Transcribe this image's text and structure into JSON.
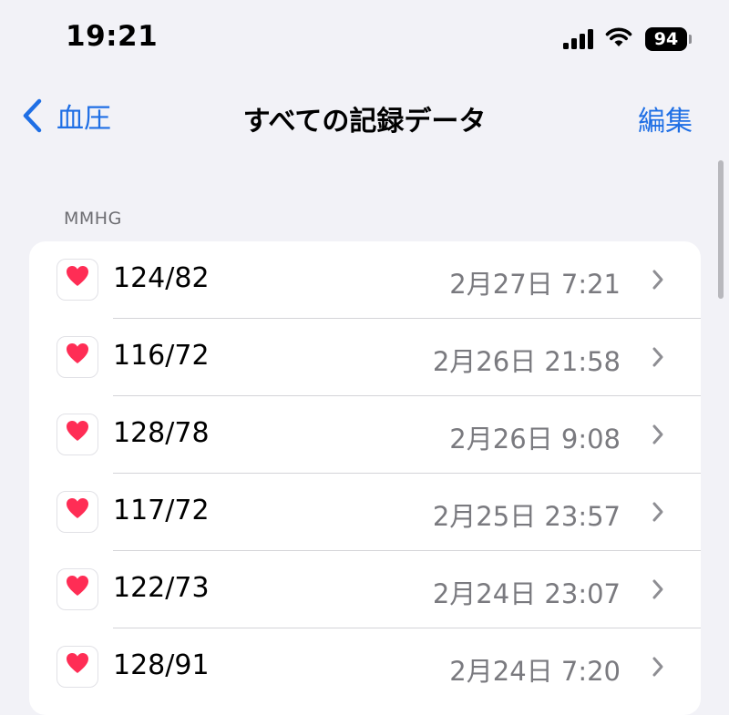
{
  "status_bar": {
    "time": "19:21",
    "battery": "94"
  },
  "nav": {
    "back_label": "血圧",
    "title": "すべての記録データ",
    "edit_label": "編集"
  },
  "section": {
    "header": "MMHG"
  },
  "records": [
    {
      "value": "124/82",
      "date": "2月27日 7:21"
    },
    {
      "value": "116/72",
      "date": "2月26日 21:58"
    },
    {
      "value": "128/78",
      "date": "2月26日 9:08"
    },
    {
      "value": "117/72",
      "date": "2月25日 23:57"
    },
    {
      "value": "122/73",
      "date": "2月24日 23:07"
    },
    {
      "value": "128/91",
      "date": "2月24日 7:20"
    }
  ],
  "icons": {
    "row_icon": "heart-icon",
    "back": "chevron-left-icon",
    "disclosure": "chevron-right-icon"
  },
  "colors": {
    "accent": "#1f6fe5",
    "heart": "#ff2d55",
    "background": "#f2f2f7",
    "secondary_text": "#7a7a7f"
  }
}
